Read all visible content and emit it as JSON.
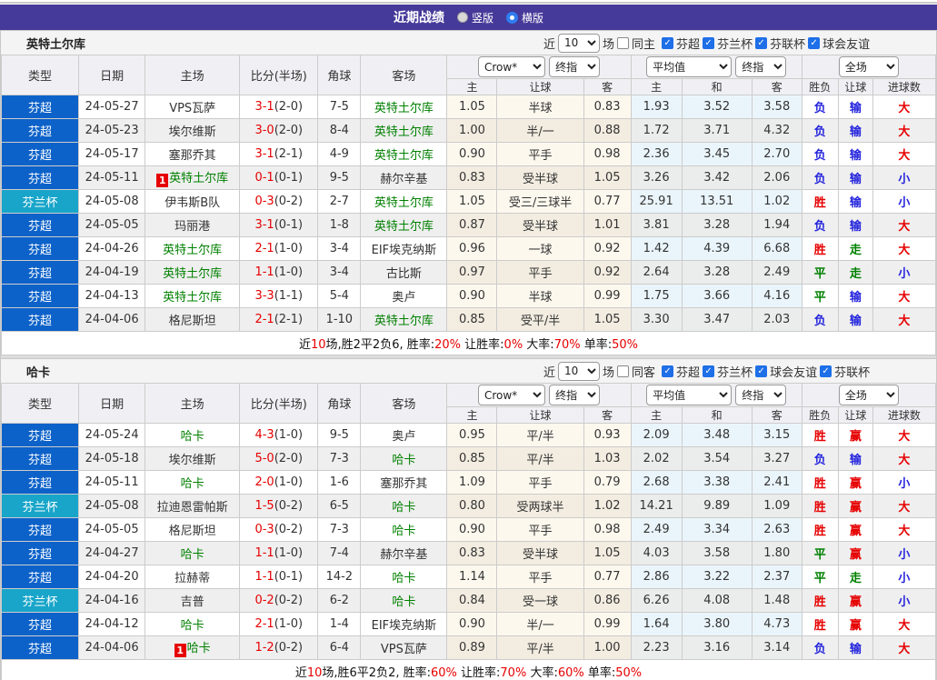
{
  "colors": {
    "accent_purple": "#453a99",
    "league_blue": "#0d62c9",
    "cup_cyan": "#18a5c9",
    "win_red": "#e60000",
    "draw_green": "#008000",
    "lose_blue": "#2424dd"
  },
  "title_bar": {
    "title": "近期战绩",
    "radios": [
      {
        "label": "竖版",
        "selected": false
      },
      {
        "label": "横版",
        "selected": true
      }
    ]
  },
  "controls": {
    "near": "近",
    "count": "10",
    "field": "场",
    "crow": "Crow*",
    "final": "终指",
    "avg": "平均值",
    "full": "全场"
  },
  "table_header": {
    "type": "类型",
    "date": "日期",
    "home": "主场",
    "score": "比分(半场)",
    "corner": "角球",
    "away": "客场",
    "sub": [
      "主",
      "让球",
      "客",
      "主",
      "和",
      "客",
      "胜负",
      "让球",
      "进球数"
    ]
  },
  "sections": [
    {
      "team": "英特土尔库",
      "filter": {
        "same": "同主",
        "leagues": [
          "芬超",
          "芬兰杯",
          "芬联杯",
          "球会友谊"
        ]
      },
      "rows": [
        {
          "league": "芬超",
          "cup": false,
          "date": "24-05-27",
          "home": "VPS瓦萨",
          "home_green": false,
          "home_badge": false,
          "score": "3-1",
          "half": "(2-0)",
          "corner": "7-5",
          "away": "英特土尔库",
          "away_green": true,
          "let": [
            "1.05",
            "半球",
            "0.83"
          ],
          "avg": [
            "1.93",
            "3.52",
            "3.58"
          ],
          "results": [
            [
              "负",
              "b"
            ],
            [
              "输",
              "b"
            ],
            [
              "大",
              "r"
            ]
          ]
        },
        {
          "league": "芬超",
          "cup": false,
          "date": "24-05-23",
          "home": "埃尔维斯",
          "home_green": false,
          "home_badge": false,
          "score": "3-0",
          "half": "(2-0)",
          "corner": "8-4",
          "away": "英特土尔库",
          "away_green": true,
          "let": [
            "1.00",
            "半/一",
            "0.88"
          ],
          "avg": [
            "1.72",
            "3.71",
            "4.32"
          ],
          "results": [
            [
              "负",
              "b"
            ],
            [
              "输",
              "b"
            ],
            [
              "大",
              "r"
            ]
          ]
        },
        {
          "league": "芬超",
          "cup": false,
          "date": "24-05-17",
          "home": "塞那乔其",
          "home_green": false,
          "home_badge": false,
          "score": "3-1",
          "half": "(2-1)",
          "corner": "4-9",
          "away": "英特土尔库",
          "away_green": true,
          "let": [
            "0.90",
            "平手",
            "0.98"
          ],
          "avg": [
            "2.36",
            "3.45",
            "2.70"
          ],
          "results": [
            [
              "负",
              "b"
            ],
            [
              "输",
              "b"
            ],
            [
              "大",
              "r"
            ]
          ]
        },
        {
          "league": "芬超",
          "cup": false,
          "date": "24-05-11",
          "home": "英特土尔库",
          "home_green": true,
          "home_badge": true,
          "score": "0-1",
          "half": "(0-1)",
          "corner": "9-5",
          "away": "赫尔辛基",
          "away_green": false,
          "let": [
            "0.83",
            "受半球",
            "1.05"
          ],
          "avg": [
            "3.26",
            "3.42",
            "2.06"
          ],
          "results": [
            [
              "负",
              "b"
            ],
            [
              "输",
              "b"
            ],
            [
              "小",
              "b"
            ]
          ]
        },
        {
          "league": "芬兰杯",
          "cup": true,
          "date": "24-05-08",
          "home": "伊韦斯B队",
          "home_green": false,
          "home_badge": false,
          "score": "0-3",
          "half": "(0-2)",
          "corner": "2-7",
          "away": "英特土尔库",
          "away_green": true,
          "let": [
            "1.05",
            "受三/三球半",
            "0.77"
          ],
          "avg": [
            "25.91",
            "13.51",
            "1.02"
          ],
          "results": [
            [
              "胜",
              "r"
            ],
            [
              "输",
              "b"
            ],
            [
              "小",
              "b"
            ]
          ]
        },
        {
          "league": "芬超",
          "cup": false,
          "date": "24-05-05",
          "home": "玛丽港",
          "home_green": false,
          "home_badge": false,
          "score": "3-1",
          "half": "(0-1)",
          "corner": "1-8",
          "away": "英特土尔库",
          "away_green": true,
          "let": [
            "0.87",
            "受半球",
            "1.01"
          ],
          "avg": [
            "3.81",
            "3.28",
            "1.94"
          ],
          "results": [
            [
              "负",
              "b"
            ],
            [
              "输",
              "b"
            ],
            [
              "大",
              "r"
            ]
          ]
        },
        {
          "league": "芬超",
          "cup": false,
          "date": "24-04-26",
          "home": "英特土尔库",
          "home_green": true,
          "home_badge": false,
          "score": "2-1",
          "half": "(1-0)",
          "corner": "3-4",
          "away": "EIF埃克纳斯",
          "away_green": false,
          "let": [
            "0.96",
            "一球",
            "0.92"
          ],
          "avg": [
            "1.42",
            "4.39",
            "6.68"
          ],
          "results": [
            [
              "胜",
              "r"
            ],
            [
              "走",
              "g"
            ],
            [
              "大",
              "r"
            ]
          ]
        },
        {
          "league": "芬超",
          "cup": false,
          "date": "24-04-19",
          "home": "英特土尔库",
          "home_green": true,
          "home_badge": false,
          "score": "1-1",
          "half": "(1-0)",
          "corner": "3-4",
          "away": "古比斯",
          "away_green": false,
          "let": [
            "0.97",
            "平手",
            "0.92"
          ],
          "avg": [
            "2.64",
            "3.28",
            "2.49"
          ],
          "results": [
            [
              "平",
              "g"
            ],
            [
              "走",
              "g"
            ],
            [
              "小",
              "b"
            ]
          ]
        },
        {
          "league": "芬超",
          "cup": false,
          "date": "24-04-13",
          "home": "英特土尔库",
          "home_green": true,
          "home_badge": false,
          "score": "3-3",
          "half": "(1-1)",
          "corner": "5-4",
          "away": "奥卢",
          "away_green": false,
          "let": [
            "0.90",
            "半球",
            "0.99"
          ],
          "avg": [
            "1.75",
            "3.66",
            "4.16"
          ],
          "results": [
            [
              "平",
              "g"
            ],
            [
              "输",
              "b"
            ],
            [
              "大",
              "r"
            ]
          ]
        },
        {
          "league": "芬超",
          "cup": false,
          "date": "24-04-06",
          "home": "格尼斯坦",
          "home_green": false,
          "home_badge": false,
          "score": "2-1",
          "half": "(2-1)",
          "corner": "1-10",
          "away": "英特土尔库",
          "away_green": true,
          "let": [
            "0.85",
            "受平/半",
            "1.05"
          ],
          "avg": [
            "3.30",
            "3.47",
            "2.03"
          ],
          "results": [
            [
              "负",
              "b"
            ],
            [
              "输",
              "b"
            ],
            [
              "大",
              "r"
            ]
          ]
        }
      ],
      "summary": [
        {
          "t": "近",
          "c": "k"
        },
        {
          "t": "10",
          "c": "r"
        },
        {
          "t": "场,胜2平2负6, 胜率:",
          "c": "k"
        },
        {
          "t": "20%",
          "c": "r"
        },
        {
          "t": " 让胜率:",
          "c": "k"
        },
        {
          "t": "0%",
          "c": "r"
        },
        {
          "t": " 大率:",
          "c": "k"
        },
        {
          "t": "70%",
          "c": "r"
        },
        {
          "t": " 单率:",
          "c": "k"
        },
        {
          "t": "50%",
          "c": "r"
        }
      ]
    },
    {
      "team": "哈卡",
      "filter": {
        "same": "同客",
        "leagues": [
          "芬超",
          "芬兰杯",
          "球会友谊",
          "芬联杯"
        ]
      },
      "rows": [
        {
          "league": "芬超",
          "cup": false,
          "date": "24-05-24",
          "home": "哈卡",
          "home_green": true,
          "home_badge": false,
          "score": "4-3",
          "half": "(1-0)",
          "corner": "9-5",
          "away": "奥卢",
          "away_green": false,
          "let": [
            "0.95",
            "平/半",
            "0.93"
          ],
          "avg": [
            "2.09",
            "3.48",
            "3.15"
          ],
          "results": [
            [
              "胜",
              "r"
            ],
            [
              "赢",
              "r"
            ],
            [
              "大",
              "r"
            ]
          ]
        },
        {
          "league": "芬超",
          "cup": false,
          "date": "24-05-18",
          "home": "埃尔维斯",
          "home_green": false,
          "home_badge": false,
          "score": "5-0",
          "half": "(2-0)",
          "corner": "7-3",
          "away": "哈卡",
          "away_green": true,
          "let": [
            "0.85",
            "平/半",
            "1.03"
          ],
          "avg": [
            "2.02",
            "3.54",
            "3.27"
          ],
          "results": [
            [
              "负",
              "b"
            ],
            [
              "输",
              "b"
            ],
            [
              "大",
              "r"
            ]
          ]
        },
        {
          "league": "芬超",
          "cup": false,
          "date": "24-05-11",
          "home": "哈卡",
          "home_green": true,
          "home_badge": false,
          "score": "2-0",
          "half": "(1-0)",
          "corner": "1-6",
          "away": "塞那乔其",
          "away_green": false,
          "let": [
            "1.09",
            "平手",
            "0.79"
          ],
          "avg": [
            "2.68",
            "3.38",
            "2.41"
          ],
          "results": [
            [
              "胜",
              "r"
            ],
            [
              "赢",
              "r"
            ],
            [
              "小",
              "b"
            ]
          ]
        },
        {
          "league": "芬兰杯",
          "cup": true,
          "date": "24-05-08",
          "home": "拉迪恩雷帕斯",
          "home_green": false,
          "home_badge": false,
          "score": "1-5",
          "half": "(0-2)",
          "corner": "6-5",
          "away": "哈卡",
          "away_green": true,
          "let": [
            "0.80",
            "受两球半",
            "1.02"
          ],
          "avg": [
            "14.21",
            "9.89",
            "1.09"
          ],
          "results": [
            [
              "胜",
              "r"
            ],
            [
              "赢",
              "r"
            ],
            [
              "大",
              "r"
            ]
          ]
        },
        {
          "league": "芬超",
          "cup": false,
          "date": "24-05-05",
          "home": "格尼斯坦",
          "home_green": false,
          "home_badge": false,
          "score": "0-3",
          "half": "(0-2)",
          "corner": "7-3",
          "away": "哈卡",
          "away_green": true,
          "let": [
            "0.90",
            "平手",
            "0.98"
          ],
          "avg": [
            "2.49",
            "3.34",
            "2.63"
          ],
          "results": [
            [
              "胜",
              "r"
            ],
            [
              "赢",
              "r"
            ],
            [
              "大",
              "r"
            ]
          ]
        },
        {
          "league": "芬超",
          "cup": false,
          "date": "24-04-27",
          "home": "哈卡",
          "home_green": true,
          "home_badge": false,
          "score": "1-1",
          "half": "(1-0)",
          "corner": "7-4",
          "away": "赫尔辛基",
          "away_green": false,
          "let": [
            "0.83",
            "受半球",
            "1.05"
          ],
          "avg": [
            "4.03",
            "3.58",
            "1.80"
          ],
          "results": [
            [
              "平",
              "g"
            ],
            [
              "赢",
              "r"
            ],
            [
              "小",
              "b"
            ]
          ]
        },
        {
          "league": "芬超",
          "cup": false,
          "date": "24-04-20",
          "home": "拉赫蒂",
          "home_green": false,
          "home_badge": false,
          "score": "1-1",
          "half": "(0-1)",
          "corner": "14-2",
          "away": "哈卡",
          "away_green": true,
          "let": [
            "1.14",
            "平手",
            "0.77"
          ],
          "avg": [
            "2.86",
            "3.22",
            "2.37"
          ],
          "results": [
            [
              "平",
              "g"
            ],
            [
              "走",
              "g"
            ],
            [
              "小",
              "b"
            ]
          ]
        },
        {
          "league": "芬兰杯",
          "cup": true,
          "date": "24-04-16",
          "home": "吉普",
          "home_green": false,
          "home_badge": false,
          "score": "0-2",
          "half": "(0-2)",
          "corner": "6-2",
          "away": "哈卡",
          "away_green": true,
          "let": [
            "0.84",
            "受一球",
            "0.86"
          ],
          "avg": [
            "6.26",
            "4.08",
            "1.48"
          ],
          "results": [
            [
              "胜",
              "r"
            ],
            [
              "赢",
              "r"
            ],
            [
              "小",
              "b"
            ]
          ]
        },
        {
          "league": "芬超",
          "cup": false,
          "date": "24-04-12",
          "home": "哈卡",
          "home_green": true,
          "home_badge": false,
          "score": "2-1",
          "half": "(1-0)",
          "corner": "1-4",
          "away": "EIF埃克纳斯",
          "away_green": false,
          "let": [
            "0.90",
            "半/一",
            "0.99"
          ],
          "avg": [
            "1.64",
            "3.80",
            "4.73"
          ],
          "results": [
            [
              "胜",
              "r"
            ],
            [
              "赢",
              "r"
            ],
            [
              "大",
              "r"
            ]
          ]
        },
        {
          "league": "芬超",
          "cup": false,
          "date": "24-04-06",
          "home": "哈卡",
          "home_green": true,
          "home_badge": true,
          "score": "1-2",
          "half": "(0-2)",
          "corner": "6-4",
          "away": "VPS瓦萨",
          "away_green": false,
          "let": [
            "0.89",
            "平/半",
            "1.00"
          ],
          "avg": [
            "2.23",
            "3.16",
            "3.14"
          ],
          "results": [
            [
              "负",
              "b"
            ],
            [
              "输",
              "b"
            ],
            [
              "大",
              "r"
            ]
          ]
        }
      ],
      "summary": [
        {
          "t": "近",
          "c": "k"
        },
        {
          "t": "10",
          "c": "r"
        },
        {
          "t": "场,胜6平2负2, 胜率:",
          "c": "k"
        },
        {
          "t": "60%",
          "c": "r"
        },
        {
          "t": " 让胜率:",
          "c": "k"
        },
        {
          "t": "70%",
          "c": "r"
        },
        {
          "t": " 大率:",
          "c": "k"
        },
        {
          "t": "60%",
          "c": "r"
        },
        {
          "t": " 单率:",
          "c": "k"
        },
        {
          "t": "50%",
          "c": "r"
        }
      ]
    }
  ]
}
